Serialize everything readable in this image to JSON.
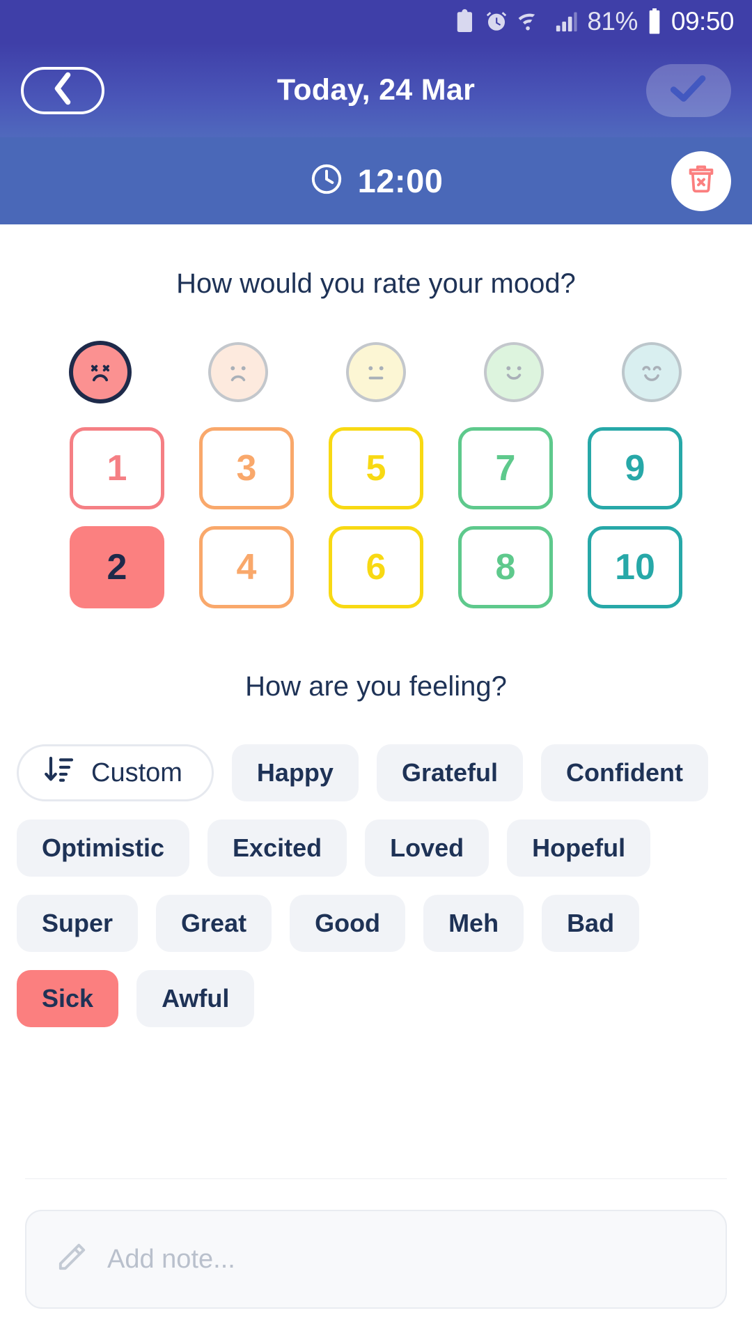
{
  "status_bar": {
    "icons": [
      "recycle-clipboard-icon",
      "alarm-icon",
      "wifi-icon",
      "signal-icon"
    ],
    "battery_percent": "81%",
    "battery_icon": "battery-icon",
    "time": "09:50"
  },
  "header": {
    "back_icon": "chevron-left-icon",
    "title": "Today, 24 Mar",
    "confirm_icon": "check-icon",
    "colors": {
      "gradient_top": "#3f3fa8",
      "gradient_bottom": "#5069bd"
    }
  },
  "time_bar": {
    "clock_icon": "clock-icon",
    "time": "12:00",
    "delete_icon": "trash-x-icon",
    "background": "#4a68b8",
    "delete_icon_color": "#fb7f7f"
  },
  "mood_section": {
    "title": "How would you rate your mood?",
    "faces": [
      {
        "name": "face-awful",
        "expression": "x-eyes-frown",
        "fill": "#fb9191",
        "border": "#1e2a4a",
        "selected": true
      },
      {
        "name": "face-bad",
        "expression": "frown",
        "fill": "#fdeade",
        "border": "#c3c7cc",
        "selected": false
      },
      {
        "name": "face-neutral",
        "expression": "flat",
        "fill": "#fcf6d4",
        "border": "#c3c7cc",
        "selected": false
      },
      {
        "name": "face-good",
        "expression": "smile",
        "fill": "#ddf4de",
        "border": "#c3c7cc",
        "selected": false
      },
      {
        "name": "face-great",
        "expression": "happy-closed-eyes",
        "fill": "#d9eff0",
        "border": "#bcc6cb",
        "selected": false
      }
    ],
    "numbers": [
      {
        "value": "1",
        "color": "#f57f84",
        "selected": false
      },
      {
        "value": "3",
        "color": "#f9a86b",
        "selected": false
      },
      {
        "value": "5",
        "color": "#f8d913",
        "selected": false
      },
      {
        "value": "7",
        "color": "#5ec98c",
        "selected": false
      },
      {
        "value": "9",
        "color": "#27a8a8",
        "selected": false
      },
      {
        "value": "2",
        "color": "#f57f84",
        "selected": true
      },
      {
        "value": "4",
        "color": "#f9a86b",
        "selected": false
      },
      {
        "value": "6",
        "color": "#f8d913",
        "selected": false
      },
      {
        "value": "8",
        "color": "#5ec98c",
        "selected": false
      },
      {
        "value": "10",
        "color": "#27a8a8",
        "selected": false
      }
    ],
    "selected_number": "2",
    "selected_fill": "#fb8080"
  },
  "feelings_section": {
    "title": "How are you feeling?",
    "custom_button": {
      "label": "Custom",
      "icon": "sort-descending-icon"
    },
    "tags": [
      {
        "label": "Happy",
        "selected": false
      },
      {
        "label": "Grateful",
        "selected": false
      },
      {
        "label": "Confident",
        "selected": false
      },
      {
        "label": "Optimistic",
        "selected": false
      },
      {
        "label": "Excited",
        "selected": false
      },
      {
        "label": "Loved",
        "selected": false
      },
      {
        "label": "Hopeful",
        "selected": false
      },
      {
        "label": "Super",
        "selected": false
      },
      {
        "label": "Great",
        "selected": false
      },
      {
        "label": "Good",
        "selected": false
      },
      {
        "label": "Meh",
        "selected": false
      },
      {
        "label": "Bad",
        "selected": false
      },
      {
        "label": "Sick",
        "selected": true
      },
      {
        "label": "Awful",
        "selected": false
      }
    ],
    "selected_tag_color": "#fb7f7f"
  },
  "note": {
    "placeholder": "Add note...",
    "icon": "pencil-icon"
  }
}
